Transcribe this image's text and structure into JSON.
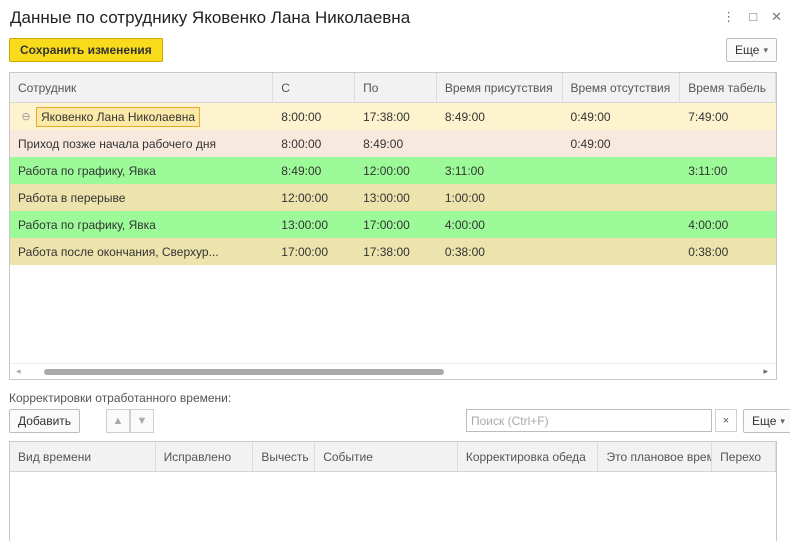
{
  "window": {
    "title": "Данные по сотруднику Яковенко Лана Николаевна",
    "controls": {
      "menu": "⋮",
      "maximize": "□",
      "close": "✕"
    }
  },
  "toolbar": {
    "save_label": "Сохранить изменения",
    "more_label": "Еще",
    "more_arrow": "▾"
  },
  "main_table": {
    "columns": [
      "Сотрудник",
      "С",
      "По",
      "Время присутствия",
      "Время отсутствия",
      "Время табель"
    ],
    "rows": [
      {
        "employee": "Яковенко Лана Николаевна",
        "from": "8:00:00",
        "to": "17:38:00",
        "present": "8:49:00",
        "absent": "0:49:00",
        "tabel": "7:49:00",
        "color": "#fdf3cf"
      },
      {
        "employee": "Приход позже начала рабочего дня",
        "from": "8:00:00",
        "to": "8:49:00",
        "present": "",
        "absent": "0:49:00",
        "tabel": "",
        "color": "#f8e9de"
      },
      {
        "employee": "Работа по графику, Явка",
        "from": "8:49:00",
        "to": "12:00:00",
        "present": "3:11:00",
        "absent": "",
        "tabel": "3:11:00",
        "color": "#9cfb98"
      },
      {
        "employee": "Работа в перерыве",
        "from": "12:00:00",
        "to": "13:00:00",
        "present": "1:00:00",
        "absent": "",
        "tabel": "",
        "color": "#ede3ad"
      },
      {
        "employee": "Работа по графику, Явка",
        "from": "13:00:00",
        "to": "17:00:00",
        "present": "4:00:00",
        "absent": "",
        "tabel": "4:00:00",
        "color": "#9cfb98"
      },
      {
        "employee": "Работа после окончания, Сверхур...",
        "from": "17:00:00",
        "to": "17:38:00",
        "present": "0:38:00",
        "absent": "",
        "tabel": "0:38:00",
        "color": "#ede3ad"
      }
    ]
  },
  "corrections": {
    "label": "Корректировки отработанного времени:",
    "add_label": "Добавить",
    "search_placeholder": "Поиск (Ctrl+F)",
    "clear_symbol": "×",
    "more_label": "Еще",
    "columns": [
      "Вид времени",
      "Исправлено",
      "Вычесть",
      "Событие",
      "Корректировка обеда",
      "Это плановое время",
      "Перехо"
    ]
  }
}
